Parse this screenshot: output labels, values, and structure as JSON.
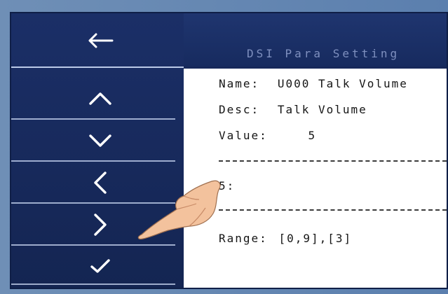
{
  "header": {
    "title": "DSI Para Setting"
  },
  "sidebar": {
    "back_icon": "back-arrow-icon",
    "buttons": [
      {
        "icon": "chevron-up-icon"
      },
      {
        "icon": "chevron-down-icon"
      },
      {
        "icon": "chevron-left-icon"
      },
      {
        "icon": "chevron-right-icon"
      },
      {
        "icon": "check-icon"
      }
    ]
  },
  "param": {
    "name_label": "Name:",
    "name_value": "U000 Talk Volume",
    "desc_label": "Desc:",
    "desc_value": "Talk Volume",
    "value_label": "Value:",
    "value_value": "5",
    "edit_label": "5:",
    "range_label": "Range:",
    "range_value": "[0,9],[3]"
  },
  "colors": {
    "sidebar": "#1b2f67",
    "content": "#ffffff",
    "text": "#151515"
  }
}
